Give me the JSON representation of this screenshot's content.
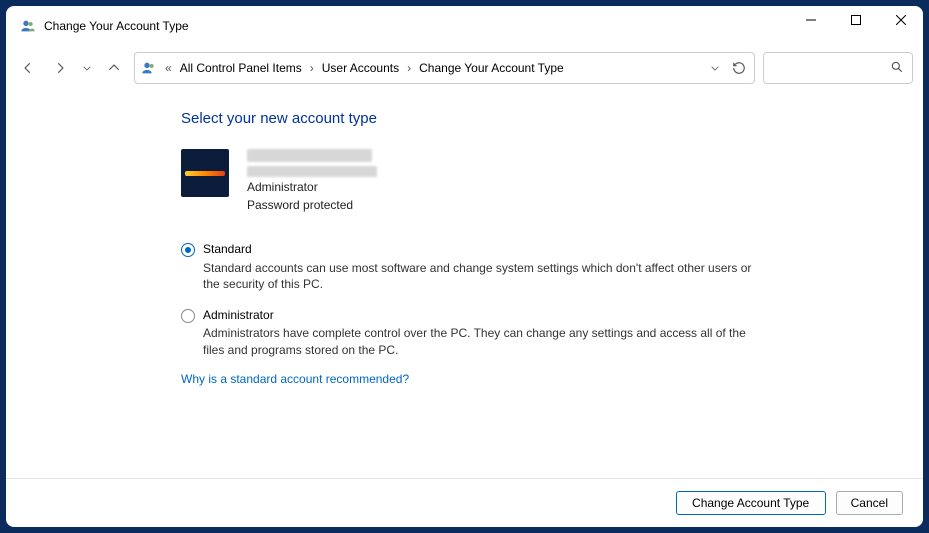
{
  "window": {
    "title": "Change Your Account Type"
  },
  "breadcrumb": {
    "items": [
      {
        "label": "All Control Panel Items"
      },
      {
        "label": "User Accounts"
      },
      {
        "label": "Change Your Account Type"
      }
    ]
  },
  "heading": "Select your new account type",
  "account": {
    "role": "Administrator",
    "status": "Password protected"
  },
  "options": [
    {
      "label": "Standard",
      "description": "Standard accounts can use most software and change system settings which don't affect other users or the security of this PC.",
      "selected": true
    },
    {
      "label": "Administrator",
      "description": "Administrators have complete control over the PC. They can change any settings and access all of the files and programs stored on the PC.",
      "selected": false
    }
  ],
  "help_link": "Why is a standard account recommended?",
  "footer": {
    "primary": "Change Account Type",
    "cancel": "Cancel"
  }
}
